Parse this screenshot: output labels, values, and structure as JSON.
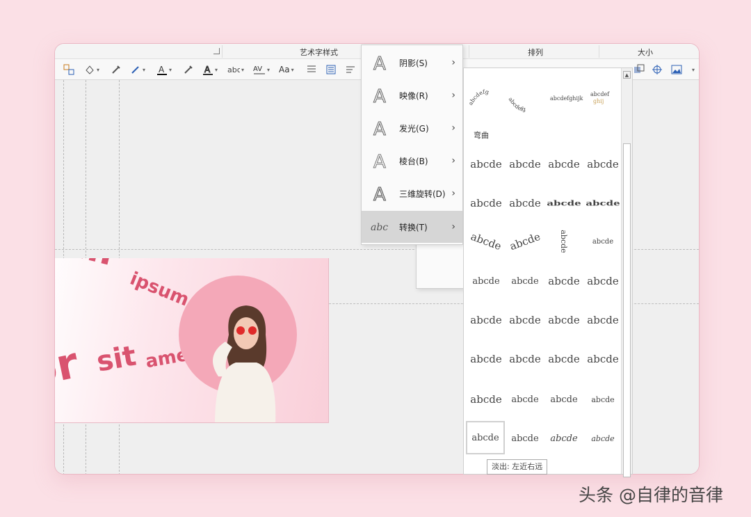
{
  "ribbon": {
    "group_wordart_label": "艺术字样式",
    "group_arrange_label": "排列",
    "group_size_label": "大小",
    "font_size_button": "Aa"
  },
  "menu": {
    "items": [
      {
        "label": "阴影(S)",
        "icon": "shadow-a-icon"
      },
      {
        "label": "映像(R)",
        "icon": "reflection-a-icon"
      },
      {
        "label": "发光(G)",
        "icon": "glow-a-icon"
      },
      {
        "label": "棱台(B)",
        "icon": "bevel-a-icon"
      },
      {
        "label": "三维旋转(D)",
        "icon": "3d-rotation-a-icon"
      },
      {
        "label": "转换(T)",
        "icon": "transform-abc-icon",
        "active": true
      }
    ]
  },
  "gallery": {
    "section_label": "弯曲",
    "sample_text": "abcde",
    "selected_tooltip": "淡出: 左近右远"
  },
  "slide": {
    "wordart_1": "rem",
    "wordart_2": "ipsum",
    "wordart_3": "or",
    "wordart_4": "sit",
    "wordart_5": "amet"
  },
  "watermark": "头条 @自律的音律",
  "colors": {
    "background": "#fbe0e6",
    "wordart": "#d9536f",
    "circle": "#f4a8b8"
  }
}
